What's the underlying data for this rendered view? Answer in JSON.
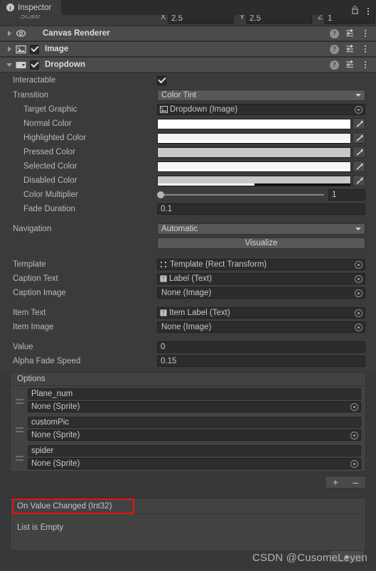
{
  "window": {
    "tab_label": "Inspector",
    "tab_icon": "info-icon",
    "lock_icon": "lock-icon",
    "menu_icon": "kebab-menu-icon"
  },
  "cut_row": {
    "label": "Scale",
    "axes": [
      {
        "name": "X",
        "value": "2.5"
      },
      {
        "name": "Y",
        "value": "2.5"
      },
      {
        "name": "Z",
        "value": "1"
      }
    ]
  },
  "components": [
    {
      "name": "Canvas Renderer",
      "expanded": false,
      "has_checkbox": false,
      "enabled": false,
      "icon": "canvas-renderer-icon"
    },
    {
      "name": "Image",
      "expanded": false,
      "has_checkbox": true,
      "enabled": true,
      "icon": "image-component-icon"
    },
    {
      "name": "Dropdown",
      "expanded": true,
      "has_checkbox": true,
      "enabled": true,
      "icon": "dropdown-component-icon"
    }
  ],
  "header_icons": {
    "help": "help-icon",
    "preset": "preset-icon",
    "menu": "kebab-menu-icon"
  },
  "dropdown": {
    "interactable": {
      "label": "Interactable",
      "checked": true
    },
    "transition": {
      "label": "Transition",
      "value": "Color Tint"
    },
    "target_graphic": {
      "label": "Target Graphic",
      "value": "Dropdown (Image)",
      "icon": "image-asset-icon"
    },
    "colors": [
      {
        "label": "Normal Color",
        "hex": "#ffffff",
        "alpha": 100
      },
      {
        "label": "Highlighted Color",
        "hex": "#f5f5f5",
        "alpha": 100
      },
      {
        "label": "Pressed Color",
        "hex": "#c8c8c8",
        "alpha": 100
      },
      {
        "label": "Selected Color",
        "hex": "#f5f5f5",
        "alpha": 100
      },
      {
        "label": "Disabled Color",
        "hex": "#c8c8c8",
        "alpha": 50
      }
    ],
    "color_multiplier": {
      "label": "Color Multiplier",
      "value": "1",
      "slider_pct": 0
    },
    "fade_duration": {
      "label": "Fade Duration",
      "value": "0.1"
    },
    "navigation": {
      "label": "Navigation",
      "value": "Automatic"
    },
    "visualize_button": "Visualize",
    "template": {
      "label": "Template",
      "value": "Template (Rect Transform)",
      "icon": "rect-transform-icon"
    },
    "caption_text": {
      "label": "Caption Text",
      "value": "Label (Text)",
      "icon": "text-asset-icon"
    },
    "caption_image": {
      "label": "Caption Image",
      "value": "None (Image)",
      "icon": "none-icon"
    },
    "item_text": {
      "label": "Item Text",
      "value": "Item Label (Text)",
      "icon": "text-asset-icon"
    },
    "item_image": {
      "label": "Item Image",
      "value": "None (Image)",
      "icon": "none-icon"
    },
    "value": {
      "label": "Value",
      "value": "0"
    },
    "alpha_fade_speed": {
      "label": "Alpha Fade Speed",
      "value": "0.15"
    },
    "options": {
      "header": "Options",
      "items": [
        {
          "text": "Plane_num",
          "sprite": "None (Sprite)"
        },
        {
          "text": "customPic",
          "sprite": "None (Sprite)"
        },
        {
          "text": "spider",
          "sprite": "None (Sprite)"
        }
      ],
      "add_label": "+",
      "remove_label": "–"
    },
    "event": {
      "title": "On Value Changed (Int32)",
      "empty_text": "List is Empty",
      "add_label": "+",
      "highlight_color": "#ee1111"
    }
  },
  "watermark": "CSDN @CusomeLeyen"
}
